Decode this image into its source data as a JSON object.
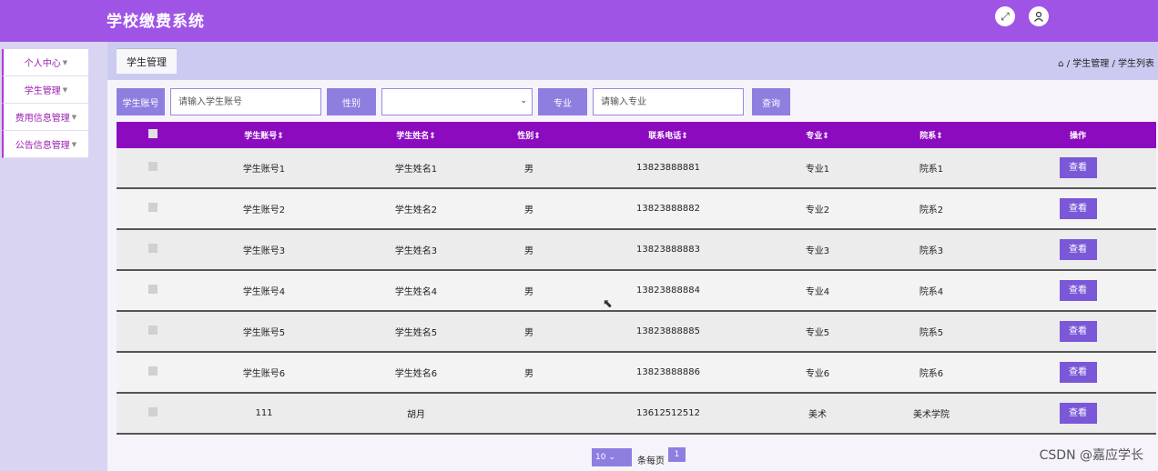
{
  "app": {
    "title": "学校缴费系统"
  },
  "header": {
    "fullscreen_icon": "fullscreen-icon",
    "user_icon": "user-icon"
  },
  "sidebar": {
    "items": [
      {
        "label": "个人中心"
      },
      {
        "label": "学生管理"
      },
      {
        "label": "费用信息管理"
      },
      {
        "label": "公告信息管理"
      }
    ]
  },
  "page": {
    "title": "学生管理",
    "breadcrumb": "/ 学生管理 / 学生列表"
  },
  "search": {
    "account_label": "学生账号",
    "account_placeholder": "请输入学生账号",
    "gender_label": "性别",
    "gender_value": "",
    "major_label": "专业",
    "major_placeholder": "请输入专业",
    "query_label": "查询"
  },
  "table": {
    "headers": [
      "学生账号⇕",
      "学生姓名⇕",
      "性别⇕",
      "联系电话⇕",
      "专业⇕",
      "院系⇕",
      "操作"
    ],
    "action_label": "查看",
    "rows": [
      {
        "account": "学生账号1",
        "name": "学生姓名1",
        "gender": "男",
        "phone": "13823888881",
        "major": "专业1",
        "dept": "院系1"
      },
      {
        "account": "学生账号2",
        "name": "学生姓名2",
        "gender": "男",
        "phone": "13823888882",
        "major": "专业2",
        "dept": "院系2"
      },
      {
        "account": "学生账号3",
        "name": "学生姓名3",
        "gender": "男",
        "phone": "13823888883",
        "major": "专业3",
        "dept": "院系3"
      },
      {
        "account": "学生账号4",
        "name": "学生姓名4",
        "gender": "男",
        "phone": "13823888884",
        "major": "专业4",
        "dept": "院系4"
      },
      {
        "account": "学生账号5",
        "name": "学生姓名5",
        "gender": "男",
        "phone": "13823888885",
        "major": "专业5",
        "dept": "院系5"
      },
      {
        "account": "学生账号6",
        "name": "学生姓名6",
        "gender": "男",
        "phone": "13823888886",
        "major": "专业6",
        "dept": "院系6"
      },
      {
        "account": "111",
        "name": "胡月",
        "gender": "",
        "phone": "13612512512",
        "major": "美术",
        "dept": "美术学院"
      }
    ]
  },
  "pagination": {
    "page_size": "10",
    "page_size_label": "条每页",
    "current_page": "1"
  },
  "watermark": "CSDN @嘉应学长"
}
